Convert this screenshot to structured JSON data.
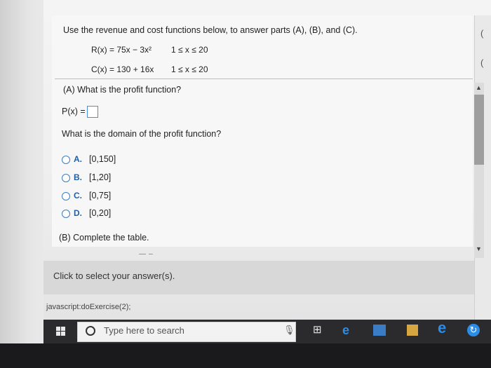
{
  "question": {
    "instructions": "Use the revenue and cost functions below, to answer parts (A), (B), and (C).",
    "revenue_fn": "R(x) = 75x − 3x²",
    "revenue_domain": "1 ≤ x ≤ 20",
    "cost_fn": "C(x) = 130 + 16x",
    "cost_domain": "1 ≤ x ≤ 20",
    "part_a_label": "(A) What is the profit function?",
    "profit_prefix": "P(x) =",
    "domain_question": "What is the domain of the profit function?",
    "options": [
      {
        "letter": "A.",
        "value": "[0,150]"
      },
      {
        "letter": "B.",
        "value": "[1,20]"
      },
      {
        "letter": "C.",
        "value": "[0,75]"
      },
      {
        "letter": "D.",
        "value": "[0,20]"
      }
    ],
    "part_b_label": "(B) Complete the table."
  },
  "footer": {
    "select_prompt": "Click to select your answer(s).",
    "status_link": "javascript:doExercise(2);"
  },
  "taskbar": {
    "search_placeholder": "Type here to search",
    "icons": [
      "windows-start-icon",
      "microphone-icon",
      "task-view-icon",
      "edge-icon",
      "store-icon",
      "store-bag-icon",
      "ie-icon",
      "refresh-icon"
    ]
  },
  "colors": {
    "accent": "#3b7dc4",
    "taskbar": "#2b2b2e"
  }
}
